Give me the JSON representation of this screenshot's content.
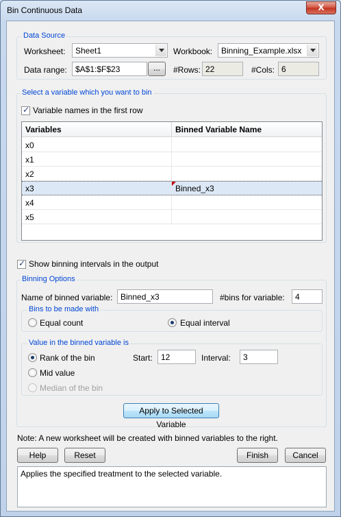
{
  "window": {
    "title": "Bin Continuous Data",
    "close_symbol": "X"
  },
  "data_source": {
    "group_title": "Data Source",
    "worksheet_label": "Worksheet:",
    "worksheet_value": "Sheet1",
    "workbook_label": "Workbook:",
    "workbook_value": "Binning_Example.xlsx",
    "range_label": "Data range:",
    "range_value": "$A$1:$F$23",
    "browse_label": "...",
    "rows_label": "#Rows:",
    "rows_value": "22",
    "cols_label": "#Cols:",
    "cols_value": "6"
  },
  "variable_select": {
    "group_title": "Select a variable which you want to bin",
    "first_row_label": "Variable names in the first row",
    "first_row_checked": true,
    "columns": [
      "Variables",
      "Binned Variable Name"
    ],
    "rows": [
      {
        "variable": "x0",
        "binned": ""
      },
      {
        "variable": "x1",
        "binned": ""
      },
      {
        "variable": "x2",
        "binned": ""
      },
      {
        "variable": "x3",
        "binned": "Binned_x3"
      },
      {
        "variable": "x4",
        "binned": ""
      },
      {
        "variable": "x5",
        "binned": ""
      }
    ],
    "selected_variable": "x3"
  },
  "show_intervals": {
    "label": "Show binning intervals in the output",
    "checked": true
  },
  "binning_options": {
    "group_title": "Binning Options",
    "name_label": "Name of binned variable:",
    "name_value": "Binned_x3",
    "bins_label": "#bins for variable:",
    "bins_value": "4",
    "bins_made_with": {
      "group_title": "Bins to be made with",
      "equal_count_label": "Equal count",
      "equal_interval_label": "Equal interval",
      "selected": "Equal interval"
    },
    "value_in_binned": {
      "group_title": "Value in the binned variable is",
      "rank_label": "Rank of the bin",
      "mid_label": "Mid value",
      "median_label": "Median of the bin",
      "selected": "Rank of the bin",
      "start_label": "Start:",
      "start_value": "12",
      "interval_label": "Interval:",
      "interval_value": "3"
    },
    "apply_label": "Apply to Selected Variable"
  },
  "note": "Note: A new worksheet will be created with binned variables to the right.",
  "buttons": {
    "help": "Help",
    "reset": "Reset",
    "finish": "Finish",
    "cancel": "Cancel"
  },
  "status_text": "Applies the specified treatment to the selected variable."
}
